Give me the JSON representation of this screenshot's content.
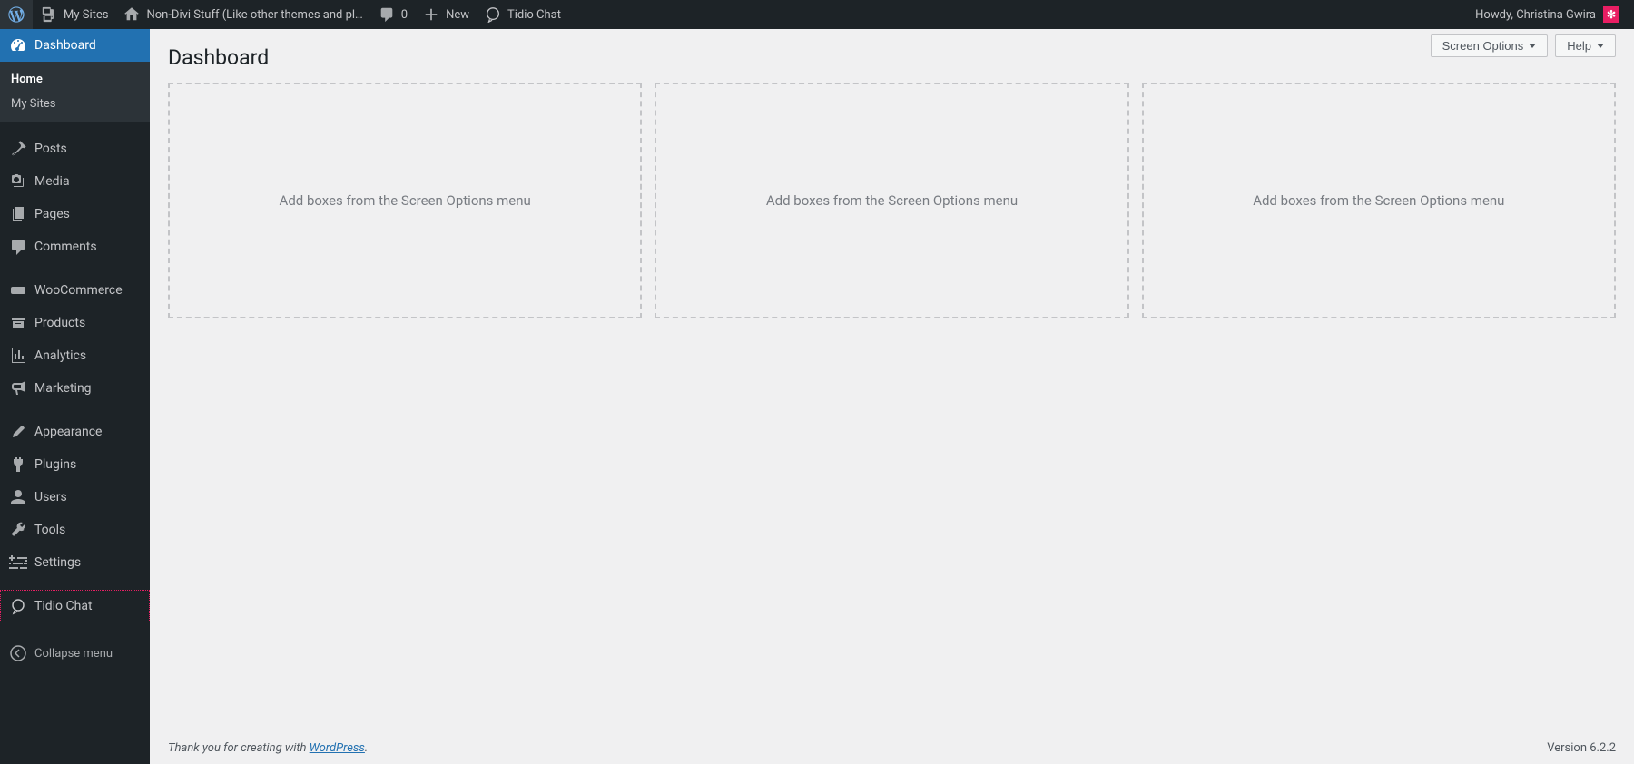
{
  "adminbar": {
    "my_sites": "My Sites",
    "site_name": "Non-Divi Stuff (Like other themes and pl…",
    "comments_count": "0",
    "new": "New",
    "tidio": "Tidio Chat",
    "greeting": "Howdy, Christina Gwira",
    "avatar_initial": "✻"
  },
  "sidebar": {
    "dashboard": "Dashboard",
    "sub_home": "Home",
    "sub_mysites": "My Sites",
    "posts": "Posts",
    "media": "Media",
    "pages": "Pages",
    "comments": "Comments",
    "woocommerce": "WooCommerce",
    "products": "Products",
    "analytics": "Analytics",
    "marketing": "Marketing",
    "appearance": "Appearance",
    "plugins": "Plugins",
    "users": "Users",
    "tools": "Tools",
    "settings": "Settings",
    "tidio": "Tidio Chat",
    "collapse": "Collapse menu"
  },
  "content": {
    "screen_options": "Screen Options",
    "help": "Help",
    "page_title": "Dashboard",
    "placeholder": "Add boxes from the Screen Options menu",
    "footer_thanks_pre": "Thank you for creating with ",
    "footer_thanks_link": "WordPress",
    "footer_version": "Version 6.2.2"
  }
}
